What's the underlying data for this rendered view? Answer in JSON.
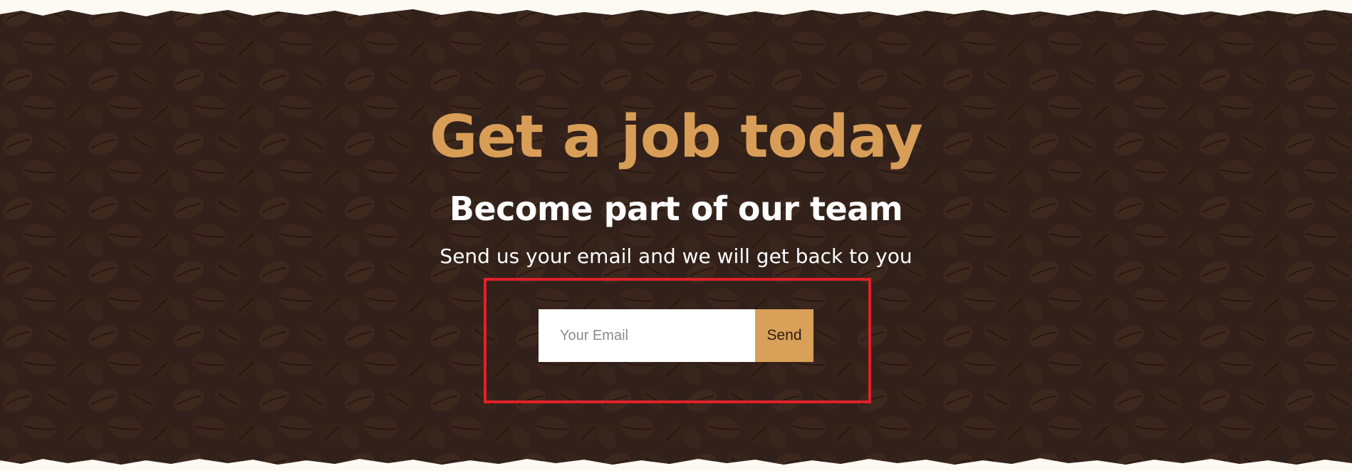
{
  "hero": {
    "headline": "Get a job today",
    "subheadline": "Become part of our team",
    "tagline": "Send us your email and we will get back to you"
  },
  "form": {
    "email_placeholder": "Your Email",
    "send_label": "Send"
  },
  "colors": {
    "page_background": "#fdf9f3",
    "hero_background": "#3a2a24",
    "headline": "#d89e58",
    "subheadline": "#ffffff",
    "tagline": "#ffffff",
    "button": "#d8a058",
    "highlight_border": "#e02129"
  }
}
